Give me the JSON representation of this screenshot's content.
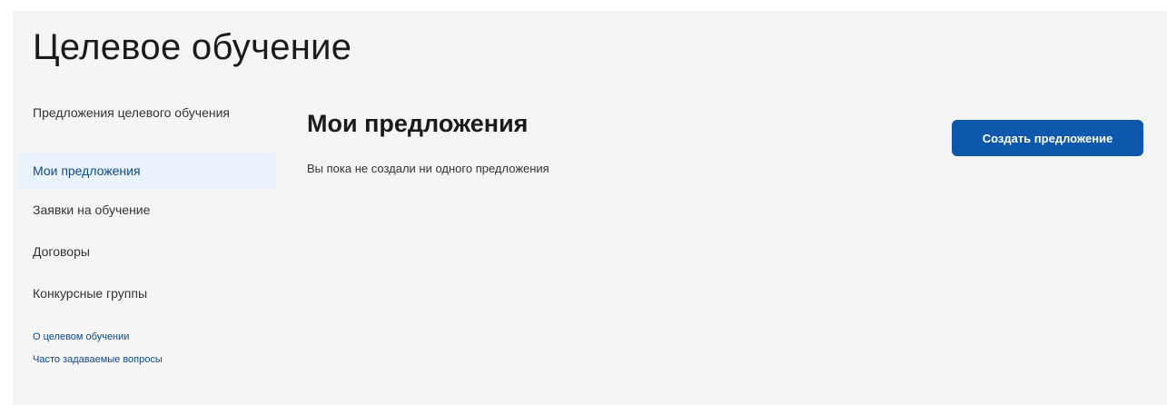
{
  "page": {
    "title": "Целевое обучение"
  },
  "sidebar": {
    "items": [
      {
        "label": "Предложения целевого обучения"
      },
      {
        "label": "Мои предложения"
      },
      {
        "label": "Заявки на обучение"
      },
      {
        "label": "Договоры"
      },
      {
        "label": "Конкурсные группы"
      }
    ],
    "links": [
      {
        "label": "О целевом обучении"
      },
      {
        "label": "Часто задаваемые вопросы"
      }
    ]
  },
  "main": {
    "section_title": "Мои предложения",
    "empty_message": "Вы пока не создали ни одного предложения",
    "create_button_label": "Создать предложение"
  },
  "colors": {
    "accent": "#0d58ad",
    "active_bg": "#eaf2fb",
    "link": "#0b4a8c",
    "page_bg": "#f5f5f5"
  }
}
